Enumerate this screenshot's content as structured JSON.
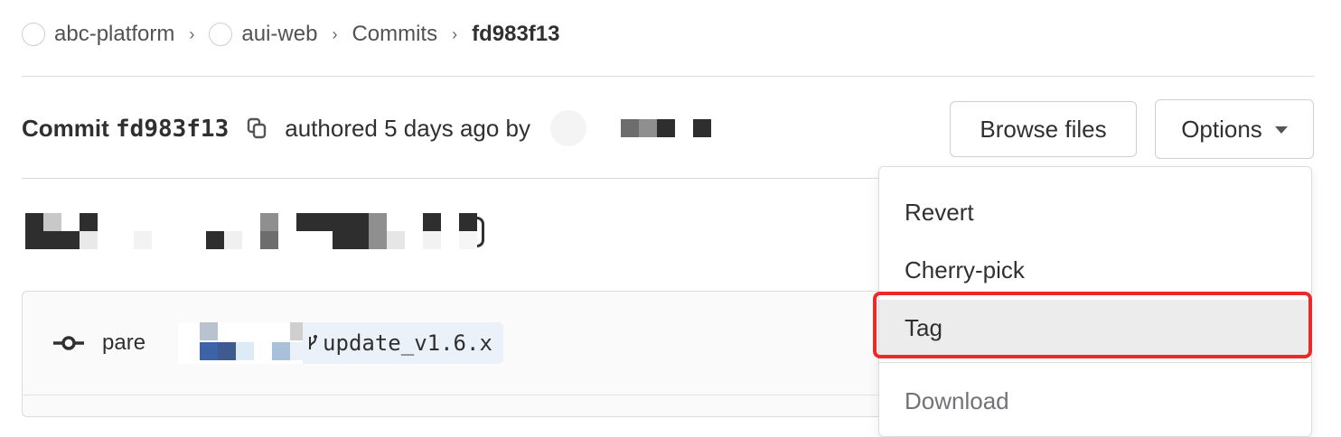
{
  "breadcrumb": {
    "items": [
      {
        "label": "abc-platform"
      },
      {
        "label": "aui-web"
      },
      {
        "label": "Commits"
      },
      {
        "label": "fd983f13"
      }
    ],
    "separator": "›"
  },
  "commit": {
    "title_prefix": "Commit",
    "sha_short": "fd983f13",
    "authored_text": "authored 5 days ago by"
  },
  "actions": {
    "browse_files_label": "Browse files",
    "options_label": "Options"
  },
  "info": {
    "parent_label": "pare",
    "branch_name": "update_v1.6.x"
  },
  "dropdown": {
    "items": [
      {
        "label": "Revert"
      },
      {
        "label": "Cherry-pick"
      },
      {
        "label": "Tag"
      },
      {
        "label": "Download"
      }
    ],
    "highlighted_item": "Tag",
    "highlight_color": "#ec2a2a"
  },
  "colors": {
    "accent_highlight": "#ec2a2a",
    "menu_hover_bg": "#ececec",
    "branch_pill_bg": "#eaf1f8"
  },
  "icons": {
    "breadcrumb_avatar": "avatar-icon",
    "copy": "copy-icon",
    "options_caret": "chevron-down-icon",
    "commit_node": "commit-icon",
    "branch": "branch-icon"
  }
}
